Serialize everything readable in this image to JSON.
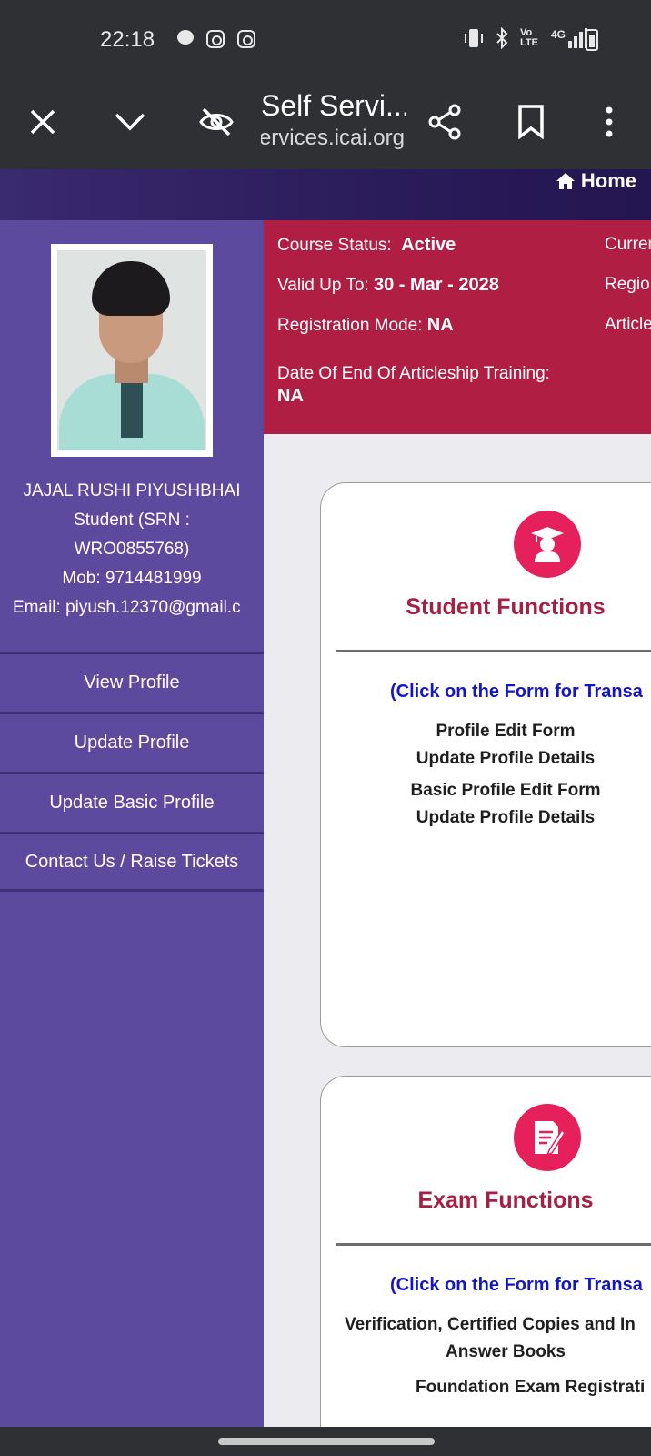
{
  "status_bar": {
    "time": "22:18",
    "network": "4G",
    "volte": "Vo LTE",
    "icons": [
      "chat-icon",
      "instagram-icon",
      "instagram-icon",
      "vibrate-icon",
      "bluetooth-icon",
      "signal-icon",
      "battery-icon"
    ]
  },
  "browser": {
    "title": "Self Servi...",
    "url": "ervices.icai.org"
  },
  "nav": {
    "home": "Home"
  },
  "profile": {
    "name": "JAJAL RUSHI PIYUSHBHAI",
    "student_line1": "Student (SRN :",
    "student_line2": "WRO0855768)",
    "mobile": "Mob: 9714481999",
    "email": "Email: piyush.12370@gmail.c"
  },
  "sidebar_menu": [
    {
      "label": "View Profile"
    },
    {
      "label": "Update Profile"
    },
    {
      "label": "Update Basic Profile"
    },
    {
      "label": "Contact Us / Raise Tickets"
    }
  ],
  "banner": {
    "course_status_label": "Course Status:",
    "course_status_value": "Active",
    "valid_up_to_label": "Valid Up To:",
    "valid_up_to_value": "30 - Mar - 2028",
    "registration_mode_label": "Registration Mode:",
    "registration_mode_value": "NA",
    "end_training_label": "Date Of End Of Articleship Training:",
    "end_training_value": "NA",
    "right_col_1": "Curren",
    "right_col_2": "Regio",
    "right_col_3": "Article"
  },
  "cards": {
    "student": {
      "title": "Student Functions",
      "note": "(Click on the Form for Transa",
      "links": [
        {
          "title": "Profile Edit Form",
          "sub": "Update Profile Details"
        },
        {
          "title": "Basic Profile Edit Form",
          "sub": "Update Profile Details"
        }
      ]
    },
    "exam": {
      "title": "Exam Functions",
      "note": "(Click on the Form for Transa",
      "link1_line1": "Verification, Certified Copies and In",
      "link1_line2": "Answer Books",
      "link2": "Foundation Exam Registrati"
    }
  }
}
